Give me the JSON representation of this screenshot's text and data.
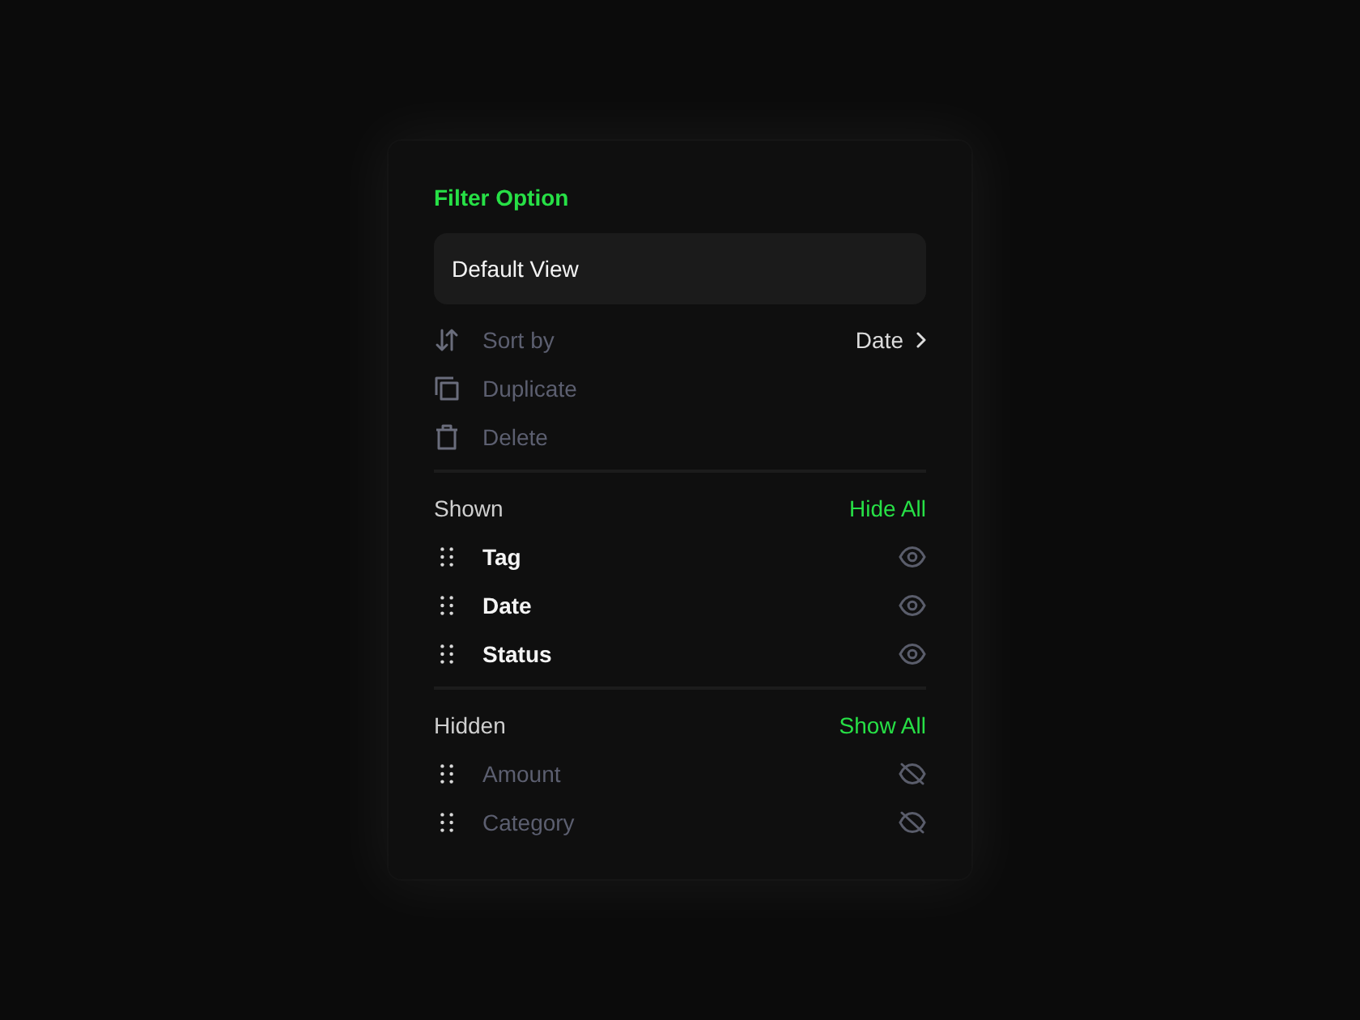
{
  "panel": {
    "title": "Filter Option",
    "view_name": {
      "value": "Default View"
    },
    "actions": [
      {
        "kind": "sort",
        "label": "Sort by",
        "value": "Date"
      },
      {
        "kind": "duplicate",
        "label": "Duplicate"
      },
      {
        "kind": "delete",
        "label": "Delete"
      }
    ],
    "groups": [
      {
        "label": "Shown",
        "toggle": "Hide All",
        "fields": [
          {
            "label": "Tag",
            "visible": true
          },
          {
            "label": "Date",
            "visible": true
          },
          {
            "label": "Status",
            "visible": true
          }
        ]
      },
      {
        "label": "Hidden",
        "toggle": "Show All",
        "fields": [
          {
            "label": "Amount",
            "visible": false
          },
          {
            "label": "Category",
            "visible": false
          }
        ]
      }
    ]
  }
}
